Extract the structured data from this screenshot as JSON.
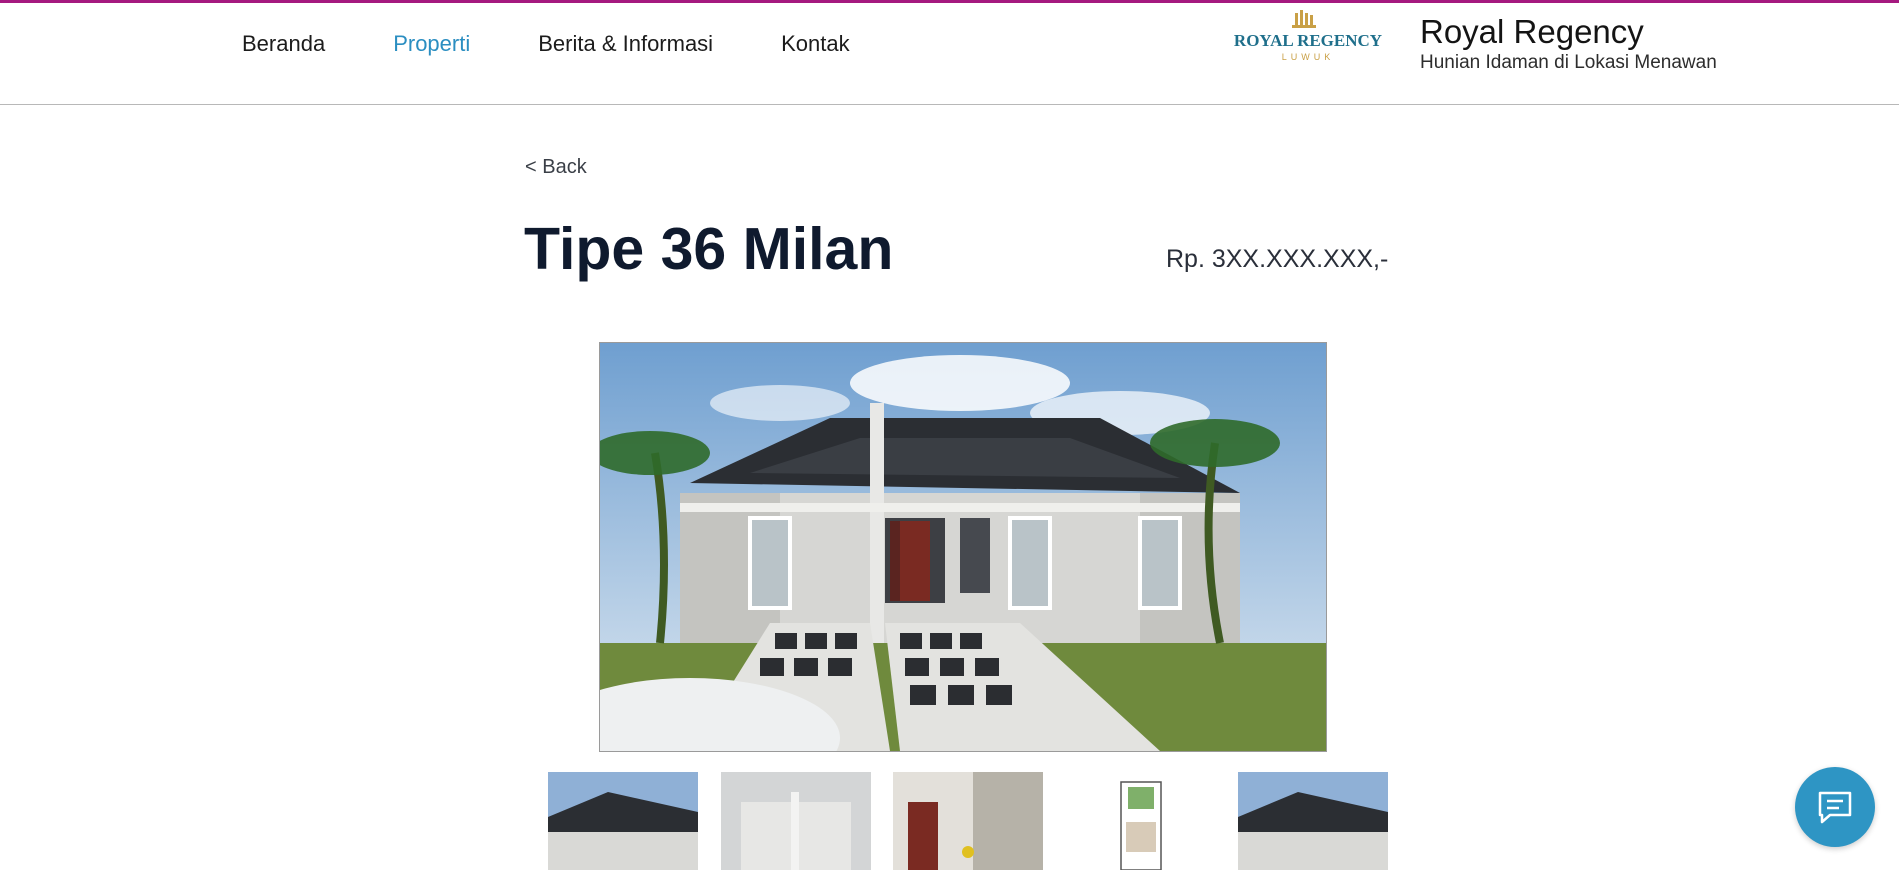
{
  "nav": {
    "items": [
      {
        "label": "Beranda",
        "active": false
      },
      {
        "label": "Properti",
        "active": true
      },
      {
        "label": "Berita & Informasi",
        "active": false
      },
      {
        "label": "Kontak",
        "active": false
      }
    ]
  },
  "brand": {
    "logo_text": "ROYAL REGENCY",
    "logo_subtext": "LUWUK",
    "title": "Royal Regency",
    "subtitle": "Hunian Idaman di Lokasi Menawan"
  },
  "page": {
    "back_label": "< Back",
    "title": "Tipe 36 Milan",
    "price": "Rp. 3XX.XXX.XXX,-"
  },
  "gallery": {
    "thumbnail_count": 5
  },
  "colors": {
    "accent": "#2b8ec1",
    "topline": "#a5197f",
    "chat_button": "#2e95c4",
    "title": "#0f1a2e"
  },
  "icons": {
    "chat": "chat-icon",
    "prev": "chevron-left-icon",
    "next": "chevron-right-icon"
  }
}
